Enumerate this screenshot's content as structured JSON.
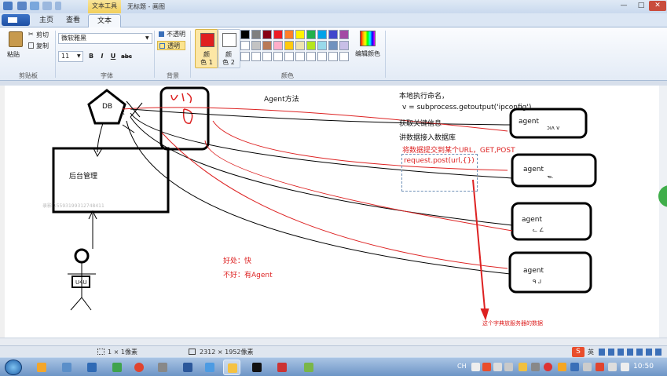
{
  "window": {
    "context_tab": "文本工具",
    "title": "无标题 - 画图",
    "minimize": "—",
    "maximize": "□",
    "close": "✕"
  },
  "tabs": [
    {
      "label": "主页"
    },
    {
      "label": "查看"
    },
    {
      "label": "文本"
    }
  ],
  "ribbon": {
    "clipboard": {
      "paste": "粘贴",
      "cut": "剪切",
      "copy": "复制",
      "group_label": "剪贴板"
    },
    "font": {
      "family": "微软雅黑",
      "size": "11",
      "bold": "B",
      "italic": "I",
      "underline": "U",
      "strike": "abc",
      "group_label": "字体"
    },
    "background": {
      "opaque": "不透明",
      "transparent": "透明",
      "group_label": "背景"
    },
    "colors": {
      "color1_label_a": "颜",
      "color1_label_b": "色 1",
      "color2_label_a": "颜",
      "color2_label_b": "色 2",
      "edit_colors": "编辑颜色",
      "group_label": "颜色",
      "color1": "#e02020",
      "color2": "#ffffff",
      "palette": [
        "#000000",
        "#7f7f7f",
        "#880015",
        "#ed1c24",
        "#ff7f27",
        "#fff200",
        "#22b14c",
        "#00a2e8",
        "#3f48cc",
        "#a349a4",
        "#ffffff",
        "#c3c3c3",
        "#b97a57",
        "#ffaec9",
        "#ffc90e",
        "#efe4b0",
        "#b5e61d",
        "#99d9ea",
        "#7092be",
        "#c8bfe7",
        "#ffffff",
        "#ffffff",
        "#ffffff",
        "#ffffff",
        "#ffffff",
        "#ffffff",
        "#ffffff",
        "#ffffff",
        "#ffffff",
        "#ffffff"
      ]
    }
  },
  "canvas": {
    "title": "Agent方法",
    "db_label": "DB",
    "db_x": "x",
    "backend": "后台管理",
    "faint_text": "录影 15593199312748411",
    "text_lines": [
      "本地执行命名，",
      "v = subprocess.getoutput('ipconfig')",
      "获取关键信息",
      "讲数据接入数据库"
    ],
    "red_lines": [
      "将数据提交到某个URL，GET,POST",
      "request.post(url,{})"
    ],
    "pros": "好处：快",
    "cons": "不好：有Agent",
    "agents": [
      "agent",
      "agent",
      "agent",
      "agent"
    ],
    "agent_scribbles": [
      "ɔıʌ ᴠ",
      "ᓀ.",
      "ᓚ ∠",
      "ᑫ ᒍ"
    ],
    "bottom_note": "这个字典放服务器的数据",
    "client_scribble": "ᑌᔦᑌ"
  },
  "statusbar": {
    "selection_size": "1 × 1像素",
    "canvas_size": "2312 × 1952像素"
  },
  "taskbar": {
    "time": "10:50",
    "ime": "英",
    "lang": "CH"
  }
}
